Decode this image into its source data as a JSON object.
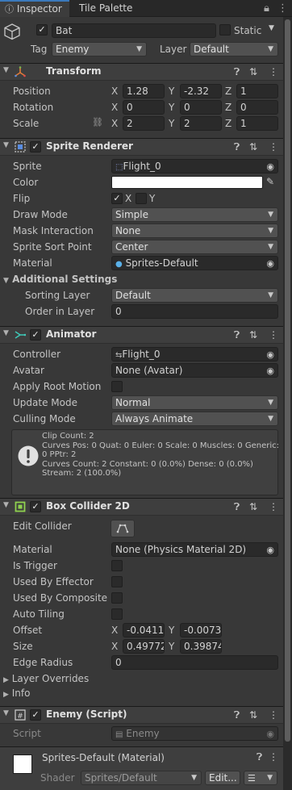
{
  "tabs": {
    "inspector": "Inspector",
    "tile_palette": "Tile Palette"
  },
  "object": {
    "name": "Bat",
    "active": true,
    "static_label": "Static",
    "tag_label": "Tag",
    "tag_value": "Enemy",
    "layer_label": "Layer",
    "layer_value": "Default"
  },
  "transform": {
    "title": "Transform",
    "position": {
      "label": "Position",
      "x": "1.28",
      "y": "-2.32",
      "z": "1"
    },
    "rotation": {
      "label": "Rotation",
      "x": "0",
      "y": "0",
      "z": "0"
    },
    "scale": {
      "label": "Scale",
      "x": "2",
      "y": "2",
      "z": "1"
    }
  },
  "axes": {
    "x": "X",
    "y": "Y",
    "z": "Z"
  },
  "sprite_renderer": {
    "title": "Sprite Renderer",
    "sprite_label": "Sprite",
    "sprite_value": "Flight_0",
    "color_label": "Color",
    "color_value": "#ffffff",
    "flip_label": "Flip",
    "flip_x": "X",
    "flip_y": "Y",
    "draw_mode_label": "Draw Mode",
    "draw_mode_value": "Simple",
    "mask_label": "Mask Interaction",
    "mask_value": "None",
    "sort_point_label": "Sprite Sort Point",
    "sort_point_value": "Center",
    "material_label": "Material",
    "material_value": "Sprites-Default",
    "additional_label": "Additional Settings",
    "sorting_layer_label": "Sorting Layer",
    "sorting_layer_value": "Default",
    "order_label": "Order in Layer",
    "order_value": "0"
  },
  "animator": {
    "title": "Animator",
    "controller_label": "Controller",
    "controller_value": "Flight_0",
    "avatar_label": "Avatar",
    "avatar_value": "None (Avatar)",
    "root_motion_label": "Apply Root Motion",
    "update_label": "Update Mode",
    "update_value": "Normal",
    "culling_label": "Culling Mode",
    "culling_value": "Always Animate",
    "info_lines": [
      "Clip Count: 2",
      "Curves Pos: 0 Quat: 0 Euler: 0 Scale: 0 Muscles: 0 Generic:",
      "0 PPtr: 2",
      "Curves Count: 2 Constant: 0 (0.0%) Dense: 0 (0.0%)",
      "Stream: 2 (100.0%)"
    ]
  },
  "box_collider": {
    "title": "Box Collider 2D",
    "edit_label": "Edit Collider",
    "material_label": "Material",
    "material_value": "None (Physics Material 2D)",
    "trigger_label": "Is Trigger",
    "effector_label": "Used By Effector",
    "composite_label": "Used By Composite",
    "tiling_label": "Auto Tiling",
    "offset_label": "Offset",
    "offset_x": "-0.0411",
    "offset_y": "-0.0073",
    "size_label": "Size",
    "size_x": "0.49772",
    "size_y": "0.39874",
    "edge_label": "Edge Radius",
    "edge_value": "0",
    "overrides_label": "Layer Overrides",
    "info_label": "Info"
  },
  "enemy_script": {
    "title": "Enemy (Script)",
    "script_label": "Script",
    "script_value": "Enemy"
  },
  "material_footer": {
    "title": "Sprites-Default (Material)",
    "shader_label": "Shader",
    "shader_value": "Sprites/Default",
    "edit_button": "Edit..."
  },
  "icons": {
    "lock": "lock-icon",
    "menu": "kebab-menu-icon",
    "help": "help-icon",
    "preset": "preset-icon",
    "warning": "warning-icon"
  }
}
